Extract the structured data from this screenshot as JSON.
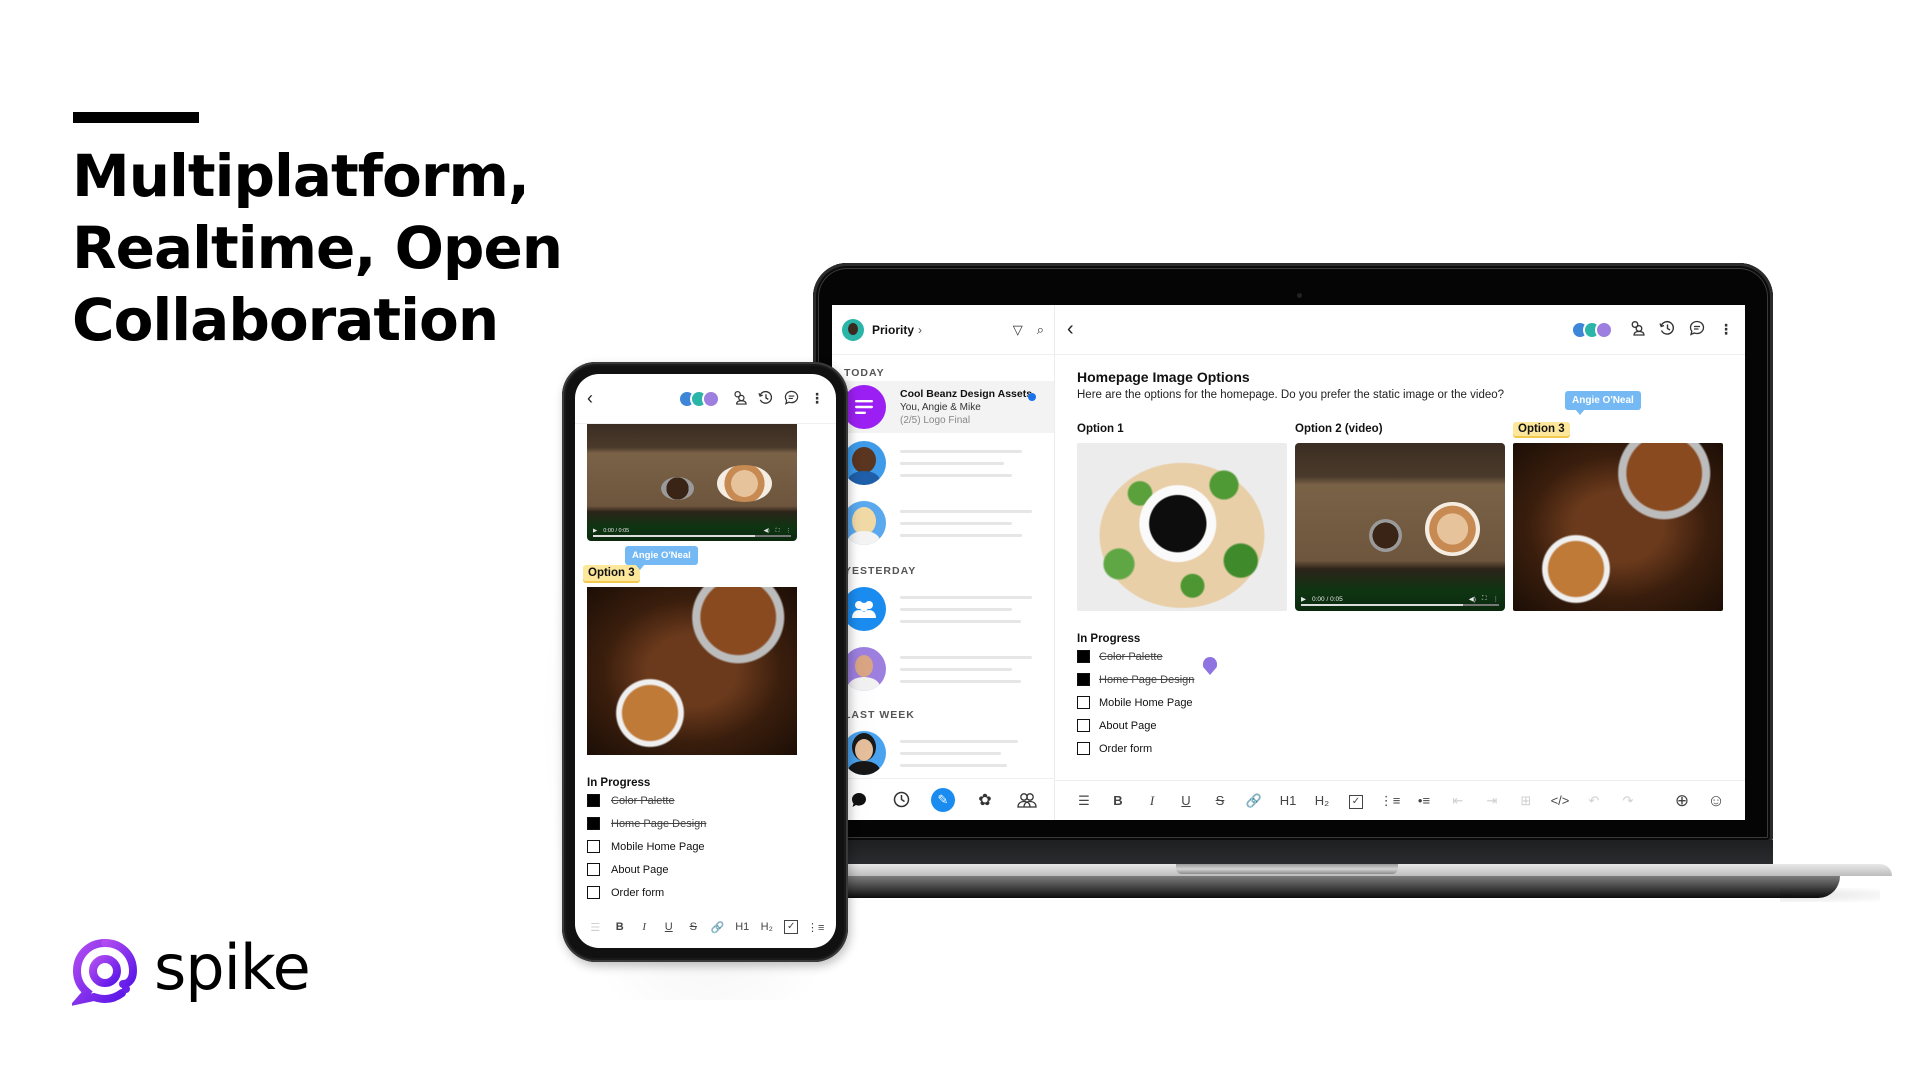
{
  "hero": {
    "headline_lines": [
      "Multiplatform,",
      "Realtime, Open",
      "Collaboration"
    ]
  },
  "brand": {
    "name": "spike",
    "logo_icon": "at-sign-chat-bubble-icon",
    "accent_color": "#7b2ff7"
  },
  "desktop_app": {
    "sidebar": {
      "inbox_label": "Priority",
      "inbox_chevron": "›",
      "header_icons": [
        "filter-icon",
        "search-icon"
      ],
      "sections": [
        {
          "label": "TODAY",
          "items": [
            {
              "title": "Cool Beanz Design Assets",
              "subtitle": "You, Angie & Mike",
              "preview": "(2/5) Logo Final",
              "unread": true,
              "avatar": "group-notes-icon",
              "avatar_color": "#9b1ff2"
            },
            {
              "avatar": "person-woman-curly-hair",
              "avatar_color": "#3d9be9"
            },
            {
              "avatar": "person-woman-blonde",
              "avatar_color": "#5aa8ee"
            }
          ]
        },
        {
          "label": "YESTERDAY",
          "items": [
            {
              "avatar": "group-people-icon",
              "avatar_color": "#1a8cf0"
            },
            {
              "avatar": "person-man-beard",
              "avatar_color": "#9d7fe0"
            }
          ]
        },
        {
          "label": "LAST WEEK",
          "items": [
            {
              "avatar": "person-woman-glasses",
              "avatar_color": "#4aa3ef"
            }
          ]
        }
      ],
      "footer_icons": [
        "chat-bubble-icon",
        "clock-icon",
        "compose-pencil-icon",
        "groups-flower-icon",
        "contacts-icon"
      ]
    },
    "header": {
      "back_icon": "chevron-left-icon",
      "collaborator_count": 3,
      "action_icons": [
        "people-icon",
        "history-icon",
        "comment-icon",
        "more-vertical-icon"
      ]
    },
    "document": {
      "title": "Homepage Image Options",
      "description": "Here are the options for the homepage. Do you prefer the static image or the video?",
      "options": [
        {
          "label": "Option 1",
          "image": "coffee cup with green leaves",
          "highlighted": false
        },
        {
          "label": "Option 2 (video)",
          "image": "espresso portafilters video",
          "highlighted": false,
          "video_time": "0:00 / 0:05"
        },
        {
          "label": "Option 3",
          "image": "coffee beans and espresso",
          "highlighted": true
        }
      ],
      "live_cursor": {
        "name": "Angie O'Neal",
        "color": "#74b8f4"
      },
      "checklist": {
        "title": "In Progress",
        "tasks": [
          {
            "label": "Color Palette",
            "done": true
          },
          {
            "label": "Home Page Design",
            "done": true
          },
          {
            "label": "Mobile Home Page",
            "done": false
          },
          {
            "label": "About Page",
            "done": false
          },
          {
            "label": "Order form",
            "done": false
          }
        ]
      }
    },
    "toolbar": {
      "buttons": [
        {
          "name": "comment",
          "glyph": "☰",
          "dim": false
        },
        {
          "name": "bold",
          "glyph": "B",
          "dim": false
        },
        {
          "name": "italic",
          "glyph": "I",
          "dim": false
        },
        {
          "name": "underline",
          "glyph": "U",
          "dim": false
        },
        {
          "name": "strikethrough",
          "glyph": "S",
          "dim": false
        },
        {
          "name": "link",
          "glyph": "🔗",
          "dim": false
        },
        {
          "name": "heading-1",
          "glyph": "H1",
          "dim": false
        },
        {
          "name": "heading-2",
          "glyph": "H₂",
          "dim": false
        },
        {
          "name": "checklist",
          "glyph": "✓",
          "dim": false
        },
        {
          "name": "numbered-list",
          "glyph": "⋮≡",
          "dim": false
        },
        {
          "name": "bullet-list",
          "glyph": "•≡",
          "dim": false
        },
        {
          "name": "outdent",
          "glyph": "⇤",
          "dim": true
        },
        {
          "name": "indent",
          "glyph": "⇥",
          "dim": true
        },
        {
          "name": "table",
          "glyph": "⊞",
          "dim": true
        },
        {
          "name": "code",
          "glyph": "</>",
          "dim": false
        },
        {
          "name": "undo",
          "glyph": "↶",
          "dim": true
        },
        {
          "name": "redo",
          "glyph": "↷",
          "dim": true
        }
      ],
      "right_buttons": [
        {
          "name": "add",
          "glyph": "⊕"
        },
        {
          "name": "emoji",
          "glyph": "☺"
        }
      ]
    }
  },
  "mobile_app": {
    "header": {
      "back_icon": "chevron-left-icon",
      "action_icons": [
        "people-icon",
        "history-icon",
        "comment-icon",
        "more-vertical-icon"
      ]
    },
    "video_time": "0:00 / 0:05",
    "live_cursor": {
      "name": "Angie O'Neal"
    },
    "option_label": "Option 3",
    "checklist": {
      "title": "In Progress",
      "tasks": [
        {
          "label": "Color Palette",
          "done": true
        },
        {
          "label": "Home Page Design",
          "done": true
        },
        {
          "label": "Mobile Home Page",
          "done": false
        },
        {
          "label": "About Page",
          "done": false
        },
        {
          "label": "Order form",
          "done": false
        }
      ]
    },
    "toolbar": [
      "☰",
      "B",
      "I",
      "U",
      "S",
      "🔗",
      "H1",
      "H₂",
      "✓",
      "⋮≡"
    ]
  }
}
